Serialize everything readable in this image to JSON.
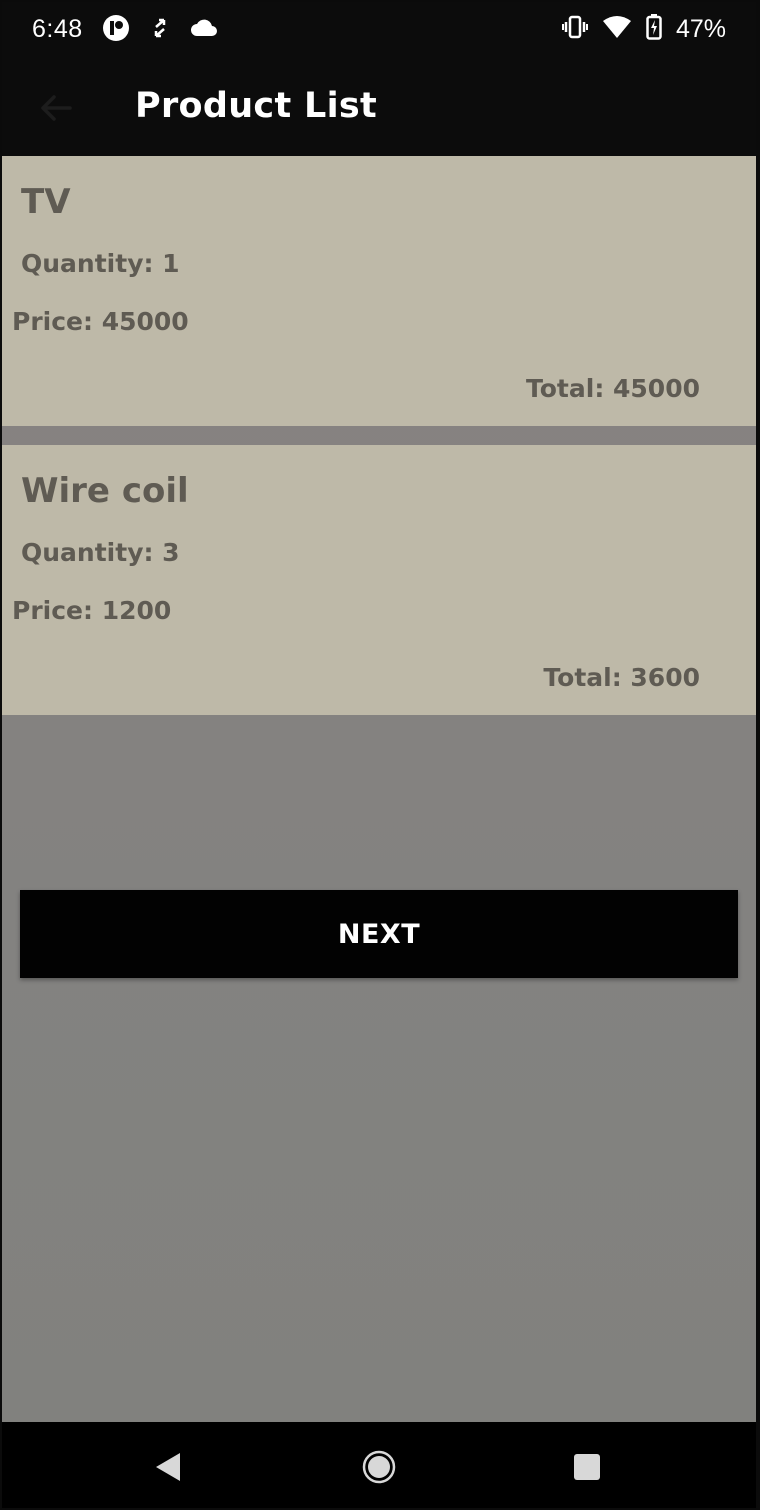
{
  "status_bar": {
    "time": "6:48",
    "battery_percent": "47%",
    "icons_left": [
      "cast-app-icon",
      "sync-arrows-icon",
      "cloud-icon"
    ],
    "icons_right": [
      "vibrate-icon",
      "wifi-icon",
      "battery-charging-icon"
    ]
  },
  "app_bar": {
    "title": "Product List",
    "back_icon": "arrow-left-icon"
  },
  "products": [
    {
      "name": "TV",
      "quantity_text": "Quantity: 1",
      "price_text": "Price: 45000",
      "total_text": "Total: 45000"
    },
    {
      "name": "Wire coil",
      "quantity_text": "Quantity: 3",
      "price_text": "Price: 1200",
      "total_text": "Total: 3600"
    }
  ],
  "actions": {
    "next_label": "NEXT"
  },
  "nav_bar": {
    "icons": [
      "nav-back-icon",
      "nav-home-icon",
      "nav-recents-icon"
    ]
  },
  "colors": {
    "card_background": "#beb9a8",
    "card_text": "#5f5b53",
    "content_background": "#858280",
    "app_bar": "#0c0c0c",
    "button": "#020202"
  }
}
